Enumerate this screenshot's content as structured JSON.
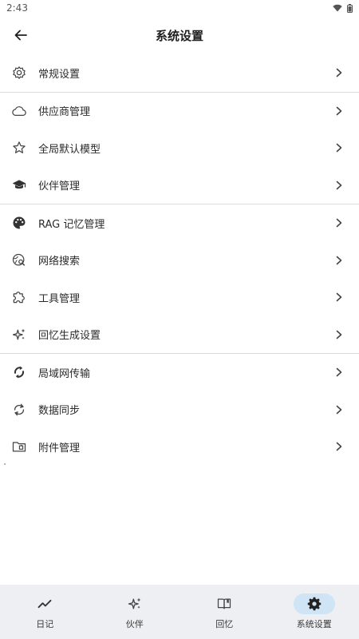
{
  "status_bar": {
    "time": "2:43"
  },
  "header": {
    "title": "系统设置"
  },
  "sections": [
    {
      "items": [
        {
          "label": "常规设置",
          "icon": "gear-icon"
        }
      ]
    },
    {
      "items": [
        {
          "label": "供应商管理",
          "icon": "cloud-icon"
        },
        {
          "label": "全局默认模型",
          "icon": "star-icon"
        },
        {
          "label": "伙伴管理",
          "icon": "graduation-cap-icon"
        }
      ]
    },
    {
      "items": [
        {
          "label": "RAG 记忆管理",
          "icon": "palette-icon"
        },
        {
          "label": "网络搜索",
          "icon": "web-search-icon"
        },
        {
          "label": "工具管理",
          "icon": "puzzle-icon"
        },
        {
          "label": "回忆生成设置",
          "icon": "sparkle-icon"
        }
      ]
    },
    {
      "items": [
        {
          "label": "局域网传输",
          "icon": "transfer-icon"
        },
        {
          "label": "数据同步",
          "icon": "sync-icon"
        },
        {
          "label": "附件管理",
          "icon": "folder-icon"
        }
      ]
    }
  ],
  "bottom_nav": {
    "items": [
      {
        "label": "日记",
        "icon": "trend-icon",
        "active": false
      },
      {
        "label": "伙伴",
        "icon": "sparkle-icon",
        "active": false
      },
      {
        "label": "回忆",
        "icon": "book-icon",
        "active": false
      },
      {
        "label": "系统设置",
        "icon": "gear-icon",
        "active": true
      }
    ],
    "active_color": "#cfe4f5"
  }
}
